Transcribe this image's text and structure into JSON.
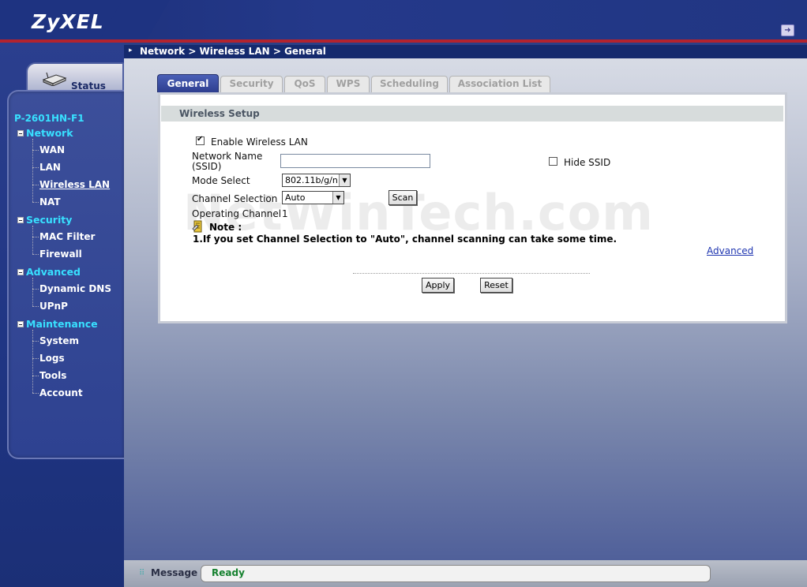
{
  "header": {
    "brand": "ZyXEL",
    "logout_icon": "logout-icon"
  },
  "breadcrumb": "Network > Wireless LAN > General",
  "sidebar": {
    "status_label": "Status",
    "model": "P-2601HN-F1",
    "groups": [
      {
        "label": "Network",
        "items": [
          "WAN",
          "LAN",
          "Wireless LAN",
          "NAT"
        ]
      },
      {
        "label": "Security",
        "items": [
          "MAC Filter",
          "Firewall"
        ]
      },
      {
        "label": "Advanced",
        "items": [
          "Dynamic DNS",
          "UPnP"
        ]
      },
      {
        "label": "Maintenance",
        "items": [
          "System",
          "Logs",
          "Tools",
          "Account"
        ]
      }
    ],
    "active_item": "Wireless LAN"
  },
  "tabs": [
    "General",
    "Security",
    "QoS",
    "WPS",
    "Scheduling",
    "Association List"
  ],
  "active_tab": "General",
  "section_title": "Wireless Setup",
  "form": {
    "enable_wlan_label": "Enable Wireless LAN",
    "enable_wlan_checked": true,
    "ssid_label_line1": "Network Name",
    "ssid_label_line2": "(SSID)",
    "ssid_value": "",
    "hide_ssid_label": "Hide SSID",
    "hide_ssid_checked": false,
    "mode_label": "Mode Select",
    "mode_value": "802.11b/g/n",
    "channel_label": "Channel Selection",
    "channel_value": "Auto",
    "scan_button": "Scan",
    "op_channel_label": "Operating Channel",
    "op_channel_value": "1"
  },
  "note": {
    "title": "Note :",
    "text": "1.If you set Channel Selection to \"Auto\", channel scanning can take some time."
  },
  "advanced_link": "Advanced",
  "buttons": {
    "apply": "Apply",
    "reset": "Reset"
  },
  "watermark": "NetWinTech.com",
  "footer": {
    "message_label": "Message",
    "message_text": "Ready"
  }
}
